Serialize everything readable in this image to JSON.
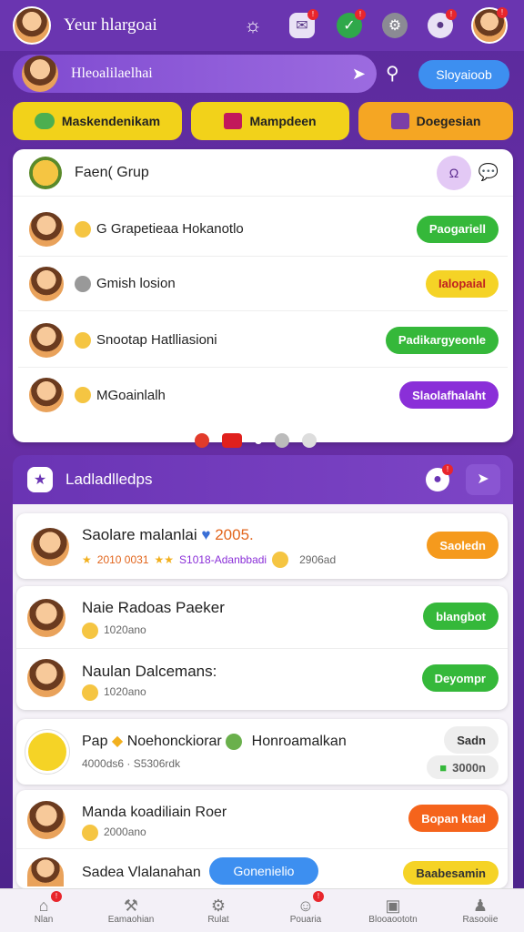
{
  "header": {
    "title": "Yeur hlargoai"
  },
  "search": {
    "label": "Hleoalilaelhai",
    "button": "Sloyaioob"
  },
  "categories": [
    {
      "label": "Maskendenikam",
      "color": "#f2d21a"
    },
    {
      "label": "Mampdeen",
      "color": "#f2d21a"
    },
    {
      "label": "Doegesian",
      "color": "#f5a623"
    }
  ],
  "group": {
    "title": "Faen( Grup",
    "rows": [
      {
        "name": "G Grapetieaa Hokanotlo",
        "button": "Paogariell",
        "color": "#35b83a"
      },
      {
        "name": "Gmish losion",
        "button": "Ialopaial",
        "color": "#f5d326",
        "dark": true
      },
      {
        "name": "Snootap Hatlliasioni",
        "button": "Padikargyeonle",
        "color": "#35b83a"
      },
      {
        "name": "MGoainlalh",
        "button": "Slaolafhalaht",
        "color": "#8a2fd8"
      }
    ]
  },
  "leaderboard": {
    "title": "Ladladlledps",
    "rows": [
      {
        "name": "Saolare malanlai",
        "extra": "2005.",
        "sub": "2010 0031",
        "sub2": "S1018-Adanbbadi",
        "sub3": "2906ad",
        "button": "Saoledn",
        "color": "#f59a1d"
      },
      {
        "name": "Naie Radoas Paeker",
        "sub": "1020ano",
        "button": "blangbot",
        "color": "#35b83a"
      },
      {
        "name": "Naulan Dalcemans:",
        "sub": "1020ano",
        "button": "Deyompr",
        "color": "#35b83a"
      },
      {
        "name": "Pap",
        "name2": "Noehonckiorar",
        "name3": "Honroamalkan",
        "sub": "4000ds6 · S5306rdk",
        "button": "Sadn",
        "button2": "3000n",
        "color": "#eeeeee"
      },
      {
        "name": "Manda koadiliain Roer",
        "sub": "2000ano",
        "button": "Bopan ktad",
        "color": "#f5641c"
      },
      {
        "name": "Sadea Vlalanahan",
        "tag": "Gonenielio",
        "button": "Baabesamin",
        "color": "#f5d326"
      }
    ]
  },
  "nav": [
    {
      "label": "Nlan",
      "icon": "home-icon"
    },
    {
      "label": "Eamaohian",
      "icon": "wrench-icon"
    },
    {
      "label": "Rulat",
      "icon": "tools-icon"
    },
    {
      "label": "Pouaria",
      "icon": "user-icon"
    },
    {
      "label": "Blooaoototn",
      "icon": "box-icon"
    },
    {
      "label": "Rasooiie",
      "icon": "profile-icon"
    }
  ]
}
